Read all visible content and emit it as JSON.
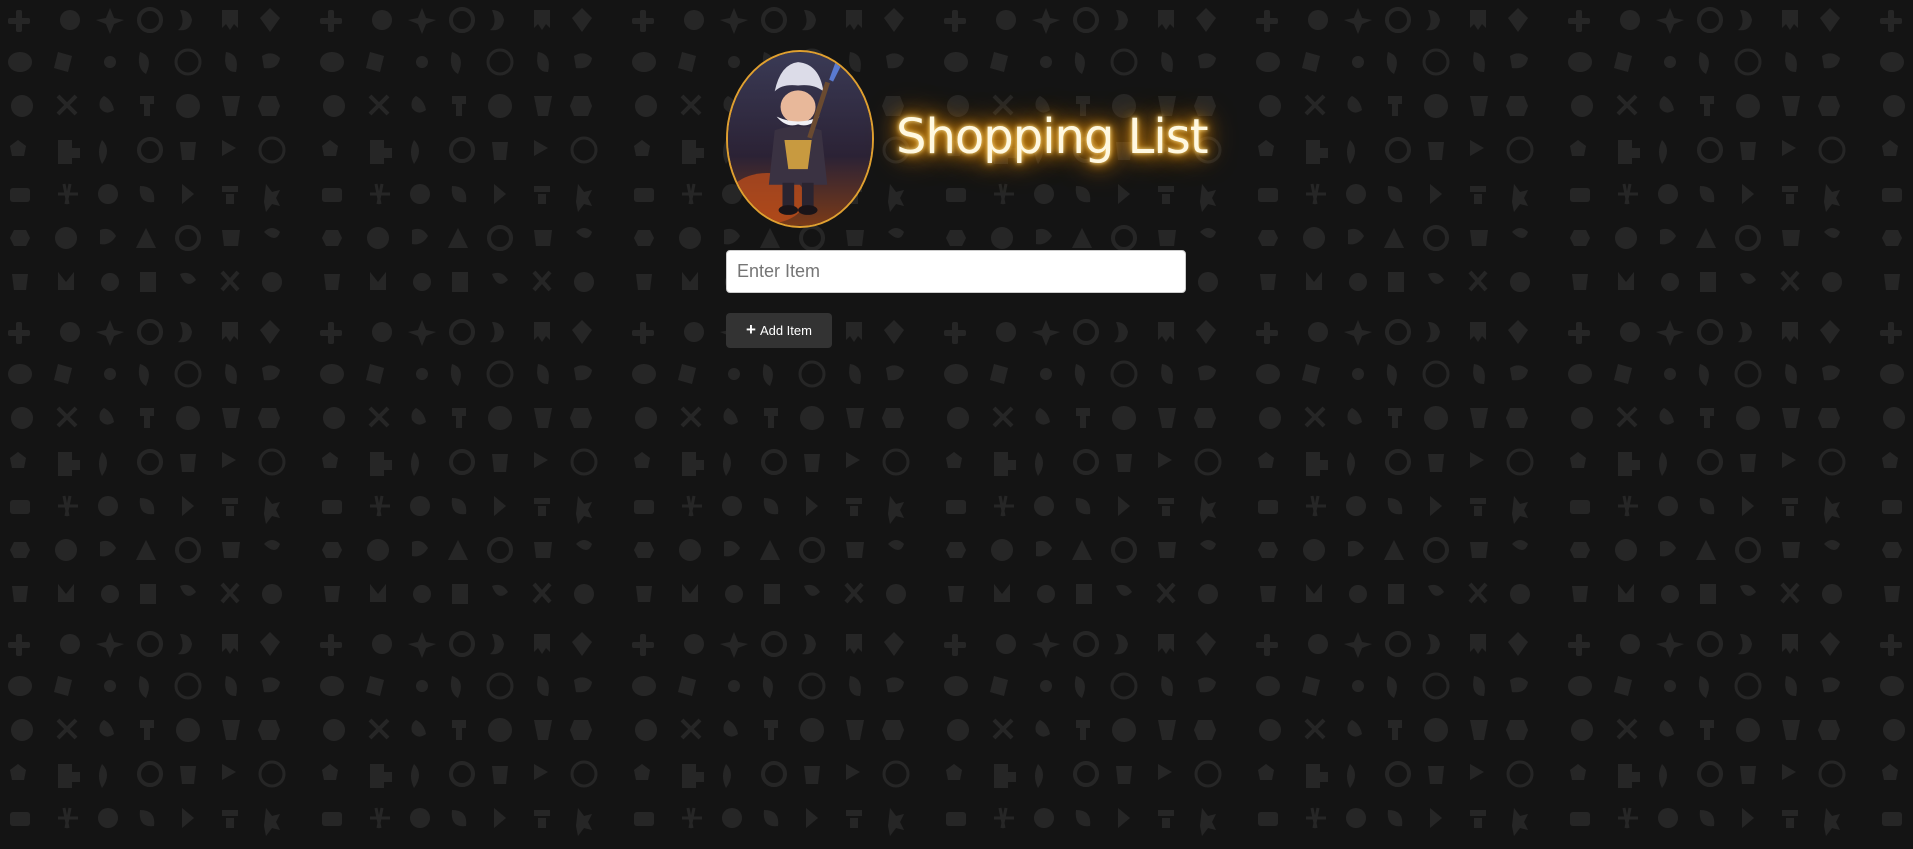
{
  "header": {
    "title": "Shopping List",
    "avatar_icon": "character-portrait-icon"
  },
  "form": {
    "input_placeholder": "Enter Item",
    "input_value": "",
    "add_button_label": "Add Item",
    "add_button_icon": "plus-icon"
  },
  "theme": {
    "background": "#141414",
    "pattern_color": "#262626",
    "accent_glow": "#ff9a00",
    "avatar_border": "#e0a030",
    "button_bg": "#333333"
  },
  "items": []
}
